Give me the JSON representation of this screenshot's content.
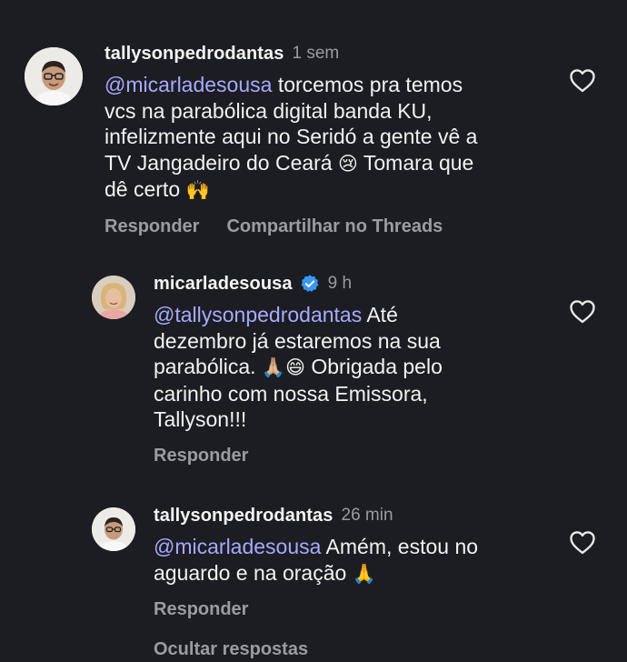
{
  "comments": [
    {
      "username": "tallysonpedrodantas",
      "time": "1 sem",
      "mention": "@micarladesousa",
      "lines": [
        " torcemos pra temos",
        "vcs na parabólica digital banda KU,",
        "infelizmente aqui no Seridó a gente vê a",
        "TV Jangadeiro do Ceará ",
        "dê certo "
      ],
      "emoji_cry": "😢",
      "line4_tail": " Tomara que",
      "emoji_hands": "🙌",
      "reply_label": "Responder",
      "share_label": "Compartilhar no Threads",
      "like_icon": "heart-outline-icon"
    },
    {
      "username": "micarladesousa",
      "verified": true,
      "time": "9 h",
      "mention": "@tallysonpedrodantas",
      "line1_tail": " Até",
      "line2": "dezembro já estaremos na sua",
      "line3_head": "parabólica. ",
      "emoji_pray": "🙏🏼",
      "emoji_smile": "😄",
      "line3_tail": " Obrigada pelo",
      "line4": "carinho com nossa Emissora,",
      "line5": "Tallyson!!!",
      "reply_label": "Responder",
      "like_icon": "heart-outline-icon"
    },
    {
      "username": "tallysonpedrodantas",
      "time": "26 min",
      "mention": "@micarladesousa",
      "line1_tail": " Amém, estou no",
      "line2_head": "aguardo e na oração ",
      "emoji_pray": "🙏",
      "reply_label": "Responder",
      "like_icon": "heart-outline-icon"
    }
  ],
  "hide_replies_label": "Ocultar respostas",
  "colors": {
    "background": "#1c1d22",
    "mention": "#a8a9ff",
    "muted": "#9b9ca2",
    "verified": "#3897f0"
  }
}
